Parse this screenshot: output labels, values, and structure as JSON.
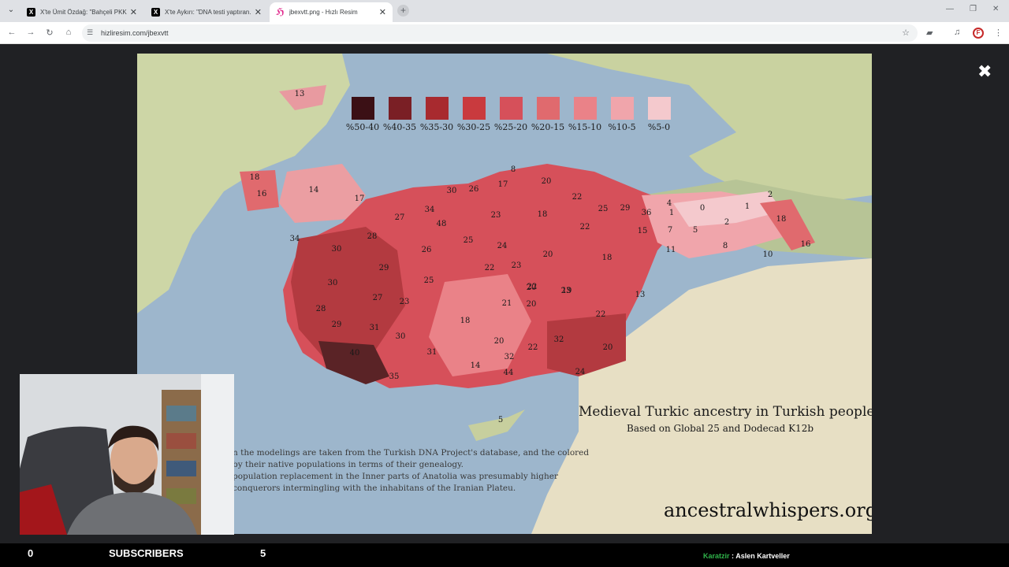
{
  "browser": {
    "tabs": [
      {
        "title": "X'te Ümit Özdağ: \"Bahçeli PKK...",
        "icon": "x-logo-icon",
        "active": false
      },
      {
        "title": "X'te Aykırı: \"DNA testi yaptıran...",
        "icon": "x-logo-icon",
        "active": false
      },
      {
        "title": "jbexvtt.png - Hızlı Resim",
        "icon": "hizliresim-icon",
        "active": true
      }
    ],
    "url": "hizliresim.com/jbexvtt"
  },
  "map": {
    "legend": [
      "%50-40",
      "%40-35",
      "%35-30",
      "%30-25",
      "%25-20",
      "%20-15",
      "%15-10",
      "%10-5",
      "%5-0"
    ],
    "legend_colors": [
      "#3b1015",
      "#7a1f25",
      "#a82a2f",
      "#c93a3e",
      "#d6505a",
      "#e06a6e",
      "#ea8288",
      "#f0a5ab",
      "#f4c9cd"
    ],
    "title": "Medieval Turkic ancestry in Turkish people",
    "subtitle": "Based on Global 25 and Dodecad K12b",
    "website": "ancestralwhispers.org",
    "note_lines": [
      "n the modelings are taken from the Turkish DNA Project's database, and the colored",
      "by their native populations in terms of their genealogy.",
      "population replacement in the Inner parts of Anatolia was presumably higher",
      "conquerors intermingling with the inhabitans of the Iranian Plateu."
    ],
    "region_values": [
      "13",
      "18",
      "16",
      "14",
      "17",
      "8",
      "17",
      "20",
      "30",
      "26",
      "34",
      "27",
      "48",
      "23",
      "18",
      "22",
      "25",
      "29",
      "36",
      "4",
      "1",
      "0",
      "1",
      "2",
      "18",
      "2",
      "5",
      "7",
      "15",
      "22",
      "8",
      "16",
      "10",
      "11",
      "34",
      "28",
      "30",
      "26",
      "25",
      "24",
      "20",
      "22",
      "23",
      "18",
      "30",
      "29",
      "25",
      "22",
      "23",
      "20",
      "21",
      "19",
      "13",
      "27",
      "23",
      "28",
      "20",
      "18",
      "22",
      "29",
      "31",
      "30",
      "20",
      "32",
      "22",
      "40",
      "31",
      "20",
      "32",
      "14",
      "44",
      "24",
      "35",
      "5"
    ]
  },
  "bottom": {
    "count_left": "0",
    "label": "SUBSCRIBERS",
    "count_right": "5",
    "ticker_key": "Karatzir",
    "ticker_value": ": Aslen Kartveller"
  }
}
